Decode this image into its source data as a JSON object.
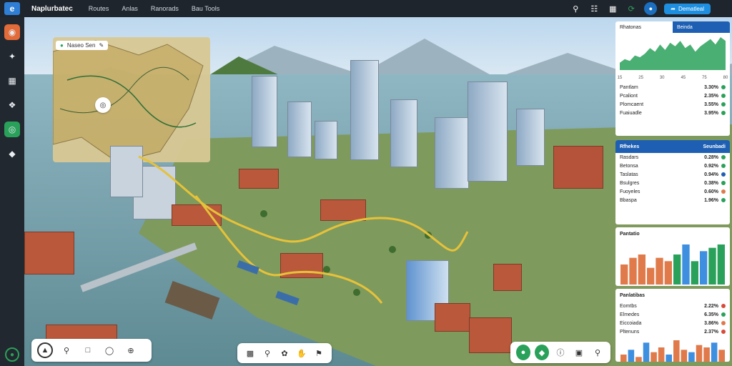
{
  "app": {
    "logo_glyph": "e",
    "title": "Naplurbatec"
  },
  "menu": [
    "Routes",
    "Anlas",
    "Ranorads",
    "Bau Tools"
  ],
  "topbar": {
    "cta_label": "Dematleal",
    "cta_icon": "share-icon"
  },
  "map": {
    "search_label": "Naseo Sen",
    "colors": {
      "water": "#6f9aa6",
      "land": "#7f9a5d",
      "route": "#e6c23a",
      "roof": "#b9583b",
      "accent": "#1e5fb3",
      "ok": "#2aa15a"
    }
  },
  "panel_stats": {
    "tabs": [
      {
        "label": "Rhatonas"
      },
      {
        "label": "Beinda"
      }
    ],
    "chart_data": {
      "type": "area",
      "values": [
        4,
        6,
        5,
        8,
        7,
        9,
        12,
        10,
        14,
        11,
        15,
        13,
        16,
        12,
        14,
        10,
        13,
        15,
        17,
        14,
        18,
        16
      ],
      "x": [
        "15",
        "25",
        "30",
        "45",
        "75",
        "80"
      ],
      "color": "#2aa15a"
    },
    "rows": [
      {
        "label": "Pantlam",
        "value": "3.30%"
      },
      {
        "label": "Pcaliont",
        "value": "2.35%"
      },
      {
        "label": "Plomcaent",
        "value": "3.55%"
      },
      {
        "label": "Fuaiuadle",
        "value": "3.95%"
      }
    ]
  },
  "panel_list": {
    "title": "Rfhekes",
    "sub": "Seunbadi",
    "rows": [
      {
        "label": "Rasdars",
        "value": "0.28%"
      },
      {
        "label": "Betonsa",
        "value": "0.92%"
      },
      {
        "label": "Taslatas",
        "value": "0.94%"
      },
      {
        "label": "Bsulgres",
        "value": "0.38%"
      },
      {
        "label": "Fuoyeles",
        "value": "0.60%"
      },
      {
        "label": "Bbaspa",
        "value": "1.96%"
      }
    ]
  },
  "panel_chart2": {
    "title": "Pantatio",
    "chart_data": {
      "type": "bar",
      "values": [
        6,
        8,
        9,
        5,
        8,
        7,
        9,
        12,
        7,
        10,
        11,
        12
      ],
      "colors": [
        "#e07a4a",
        "#e07a4a",
        "#e07a4a",
        "#e07a4a",
        "#e07a4a",
        "#e07a4a",
        "#2aa15a",
        "#3e8fe0",
        "#2aa15a",
        "#3e8fe0",
        "#2aa15a",
        "#2aa15a"
      ]
    }
  },
  "panel_list2": {
    "title": "Panlatibas",
    "rows": [
      {
        "label": "Eomtbs",
        "value": "2.22%"
      },
      {
        "label": "Elmedes",
        "value": "6.35%"
      },
      {
        "label": "Eiccoiada",
        "value": "3.86%"
      },
      {
        "label": "Pltenuns",
        "value": "2.37%"
      }
    ],
    "chart_data": {
      "type": "bar",
      "values": [
        3,
        5,
        2,
        8,
        4,
        6,
        3,
        9,
        5,
        4,
        7,
        6,
        8,
        5
      ],
      "colors": [
        "#e07a4a",
        "#3e8fe0",
        "#e07a4a",
        "#3e8fe0",
        "#e07a4a",
        "#e07a4a",
        "#3e8fe0",
        "#e07a4a",
        "#e07a4a",
        "#3e8fe0",
        "#e07a4a",
        "#e07a4a",
        "#3e8fe0",
        "#e07a4a"
      ]
    }
  }
}
